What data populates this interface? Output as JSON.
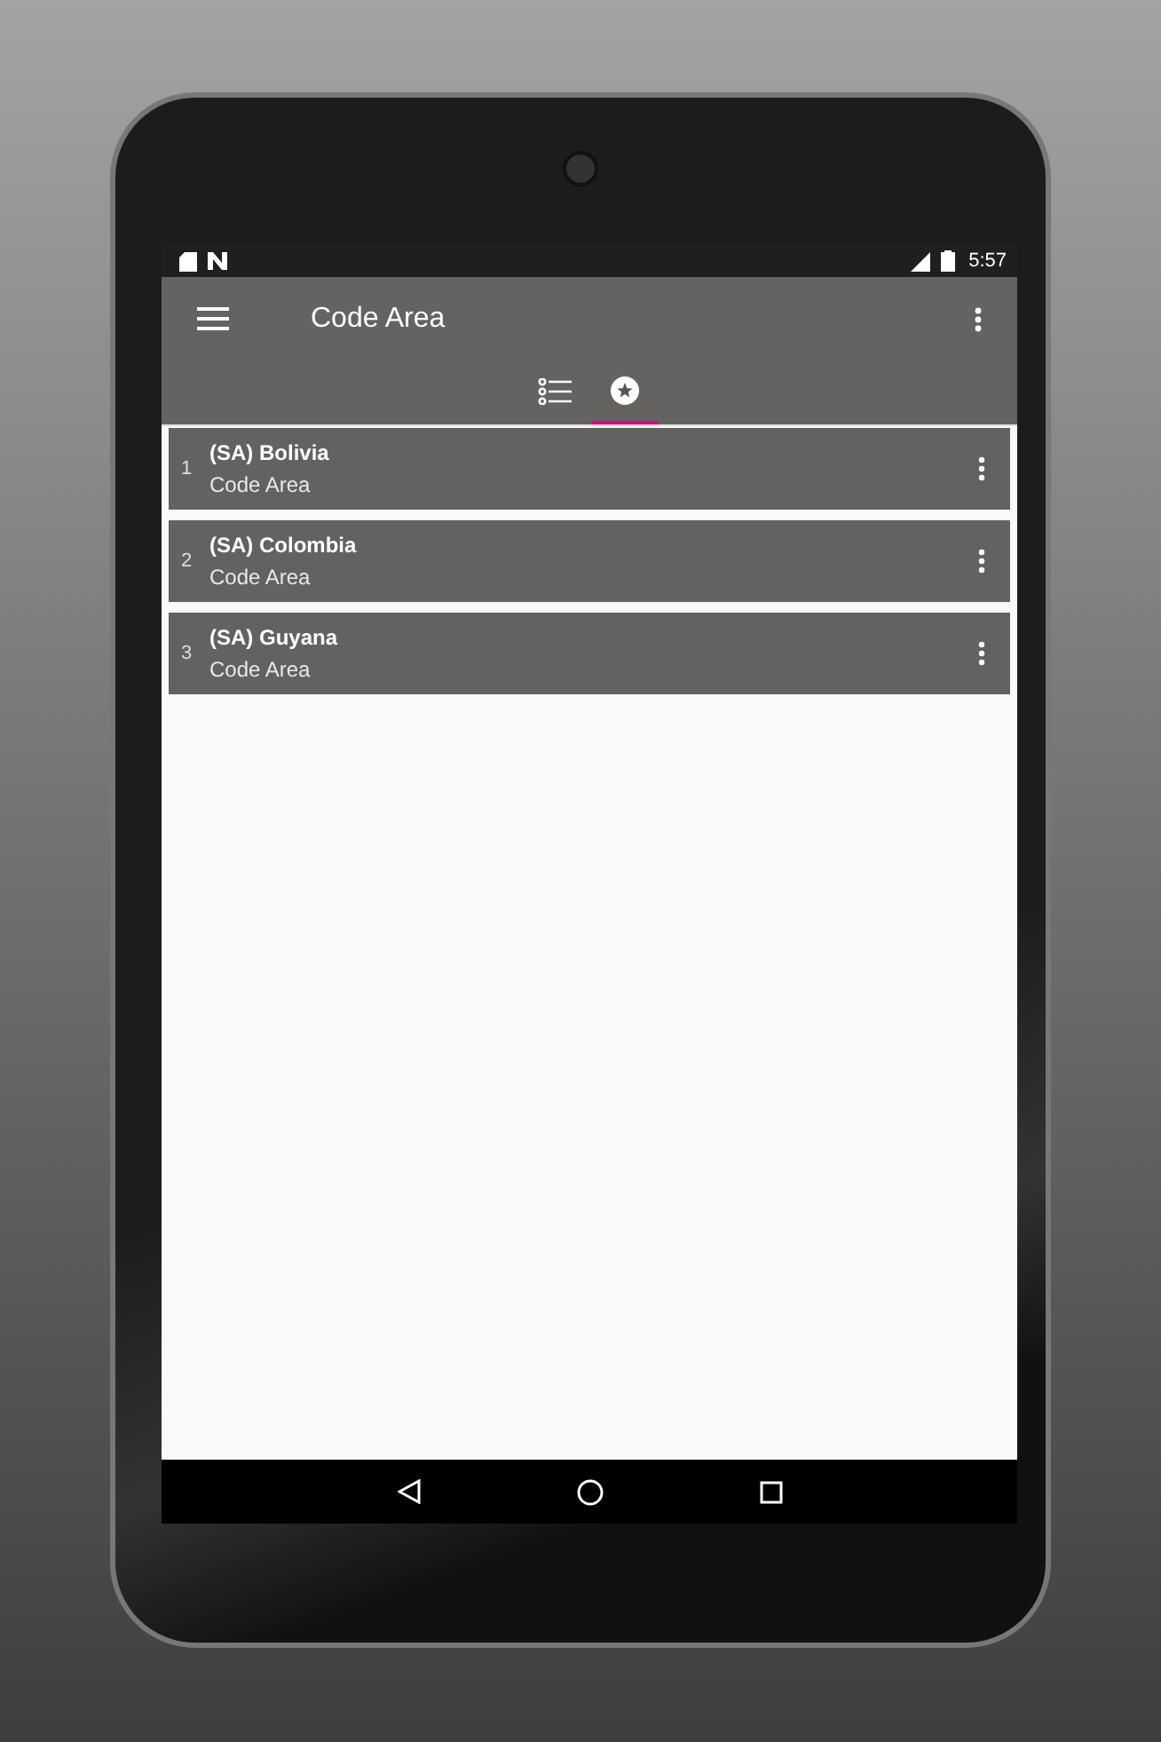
{
  "status_bar": {
    "time": "5:57"
  },
  "app_bar": {
    "title": "Code Area"
  },
  "tabs": [
    {
      "kind": "list",
      "selected": false
    },
    {
      "kind": "star",
      "selected": true
    }
  ],
  "items": [
    {
      "number": "1",
      "title": "(SA) Bolivia",
      "subtitle": "Code Area"
    },
    {
      "number": "2",
      "title": "(SA) Colombia",
      "subtitle": "Code Area"
    },
    {
      "number": "3",
      "title": "(SA) Guyana",
      "subtitle": "Code Area"
    }
  ]
}
